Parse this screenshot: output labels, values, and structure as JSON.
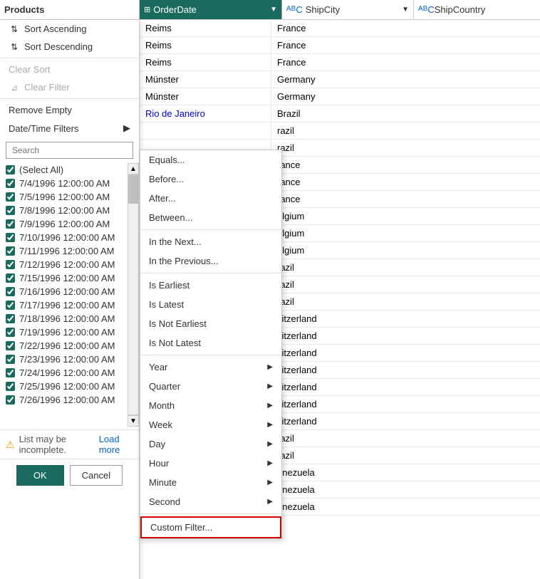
{
  "header": {
    "products_label": "Products",
    "orderdate_label": "OrderDate",
    "shipcity_label": "ShipCity",
    "shipcountry_label": "ShipCountry"
  },
  "context_menu": {
    "sort_ascending": "Sort Ascending",
    "sort_descending": "Sort Descending",
    "clear_sort": "Clear Sort",
    "clear_filter": "Clear Filter",
    "remove_empty": "Remove Empty",
    "datetime_filters": "Date/Time Filters",
    "search_placeholder": "Search",
    "select_all": "(Select All)",
    "load_more": "Load more",
    "list_warning": "List may be incomplete.",
    "ok_label": "OK",
    "cancel_label": "Cancel"
  },
  "checkbox_items": [
    "7/4/1996 12:00:00 AM",
    "7/5/1996 12:00:00 AM",
    "7/8/1996 12:00:00 AM",
    "7/9/1996 12:00:00 AM",
    "7/10/1996 12:00:00 AM",
    "7/11/1996 12:00:00 AM",
    "7/12/1996 12:00:00 AM",
    "7/15/1996 12:00:00 AM",
    "7/16/1996 12:00:00 AM",
    "7/17/1996 12:00:00 AM",
    "7/18/1996 12:00:00 AM",
    "7/19/1996 12:00:00 AM",
    "7/22/1996 12:00:00 AM",
    "7/23/1996 12:00:00 AM",
    "7/24/1996 12:00:00 AM",
    "7/25/1996 12:00:00 AM",
    "7/26/1996 12:00:00 AM"
  ],
  "datetime_submenu": {
    "equals": "Equals...",
    "before": "Before...",
    "after": "After...",
    "between": "Between...",
    "in_next": "In the Next...",
    "in_prev": "In the Previous...",
    "is_earliest": "Is Earliest",
    "is_latest": "Is Latest",
    "is_not_earliest": "Is Not Earliest",
    "is_not_latest": "Is Not Latest",
    "year": "Year",
    "quarter": "Quarter",
    "month": "Month",
    "week": "Week",
    "day": "Day",
    "hour": "Hour",
    "minute": "Minute",
    "second": "Second",
    "custom_filter": "Custom Filter..."
  },
  "table_data": [
    {
      "city": "Reims",
      "country": "France"
    },
    {
      "city": "Reims",
      "country": "France"
    },
    {
      "city": "Reims",
      "country": "France"
    },
    {
      "city": "Münster",
      "country": "Germany"
    },
    {
      "city": "Münster",
      "country": "Germany"
    },
    {
      "city": "Rio de Janeiro",
      "country": "Brazil"
    },
    {
      "city": "",
      "country": "razil"
    },
    {
      "city": "",
      "country": "razil"
    },
    {
      "city": "",
      "country": "rance"
    },
    {
      "city": "",
      "country": "rance"
    },
    {
      "city": "",
      "country": "rance"
    },
    {
      "city": "",
      "country": "elgium"
    },
    {
      "city": "",
      "country": "elgium"
    },
    {
      "city": "",
      "country": "elgium"
    },
    {
      "city": "",
      "country": "razil"
    },
    {
      "city": "",
      "country": "razil"
    },
    {
      "city": "",
      "country": "razil"
    },
    {
      "city": "",
      "country": "vitzerland"
    },
    {
      "city": "",
      "country": "vitzerland"
    },
    {
      "city": "",
      "country": "vitzerland"
    },
    {
      "city": "",
      "country": "vitzerland"
    },
    {
      "city": "",
      "country": "vitzerland"
    },
    {
      "city": "",
      "country": "vitzerland"
    },
    {
      "city": "",
      "country": "vitzerland"
    },
    {
      "city": "",
      "country": "razil"
    },
    {
      "city": "",
      "country": "razil"
    },
    {
      "city": "",
      "country": "enezuela"
    },
    {
      "city": "",
      "country": "enezuela"
    },
    {
      "city": "",
      "country": "enezuela"
    }
  ],
  "colors": {
    "header_bg": "#1a6b5e",
    "header_text": "#ffffff",
    "accent_blue": "#0066cc",
    "checked_green": "#1a6b5e",
    "warning_yellow": "#f0a000",
    "highlight_red": "#cc0000"
  }
}
